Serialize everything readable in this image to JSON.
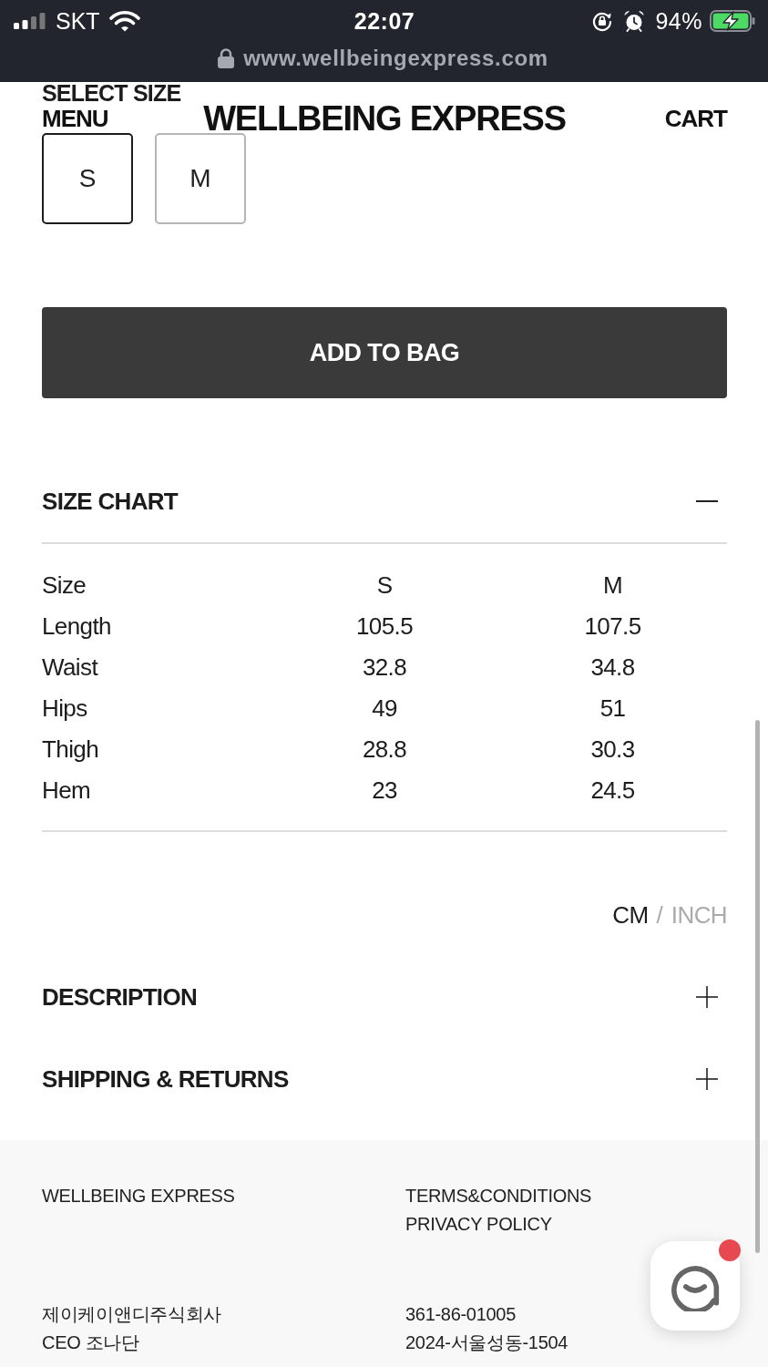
{
  "status_bar": {
    "carrier": "SKT",
    "time": "22:07",
    "battery": "94%"
  },
  "address_bar": {
    "url": "www.wellbeingexpress.com"
  },
  "header": {
    "menu": "MENU",
    "logo": "WELLBEING EXPRESS",
    "cart": "CART"
  },
  "size_selector": {
    "title": "SELECT SIZE",
    "options": [
      {
        "label": "S",
        "selected": true
      },
      {
        "label": "M",
        "selected": false
      }
    ]
  },
  "add_to_bag": "ADD TO BAG",
  "sections": [
    {
      "title": "SIZE CHART",
      "expanded": true,
      "table": {
        "rows": [
          [
            "Size",
            "S",
            "M"
          ],
          [
            "Length",
            "105.5",
            "107.5"
          ],
          [
            "Waist",
            "32.8",
            "34.8"
          ],
          [
            "Hips",
            "49",
            "51"
          ],
          [
            "Thigh",
            "28.8",
            "30.3"
          ],
          [
            "Hem",
            "23",
            "24.5"
          ]
        ]
      },
      "unit_toggle": {
        "options": [
          {
            "label": "CM",
            "selected": true
          },
          {
            "label": "INCH",
            "selected": false
          }
        ],
        "separator": "/"
      }
    },
    {
      "title": "DESCRIPTION",
      "expanded": false
    },
    {
      "title": "SHIPPING & RETURNS",
      "expanded": false
    }
  ],
  "footer": {
    "company": "WELLBEING EXPRESS",
    "links": [
      "TERMS&CONDITIONS",
      "PRIVACY POLICY"
    ],
    "company_info": [
      "제이케이앤디주식회사",
      "CEO 조나단"
    ],
    "registration": [
      "361-86-01005",
      "2024-서울성동-1504"
    ]
  },
  "chat": {
    "unread": true
  }
}
